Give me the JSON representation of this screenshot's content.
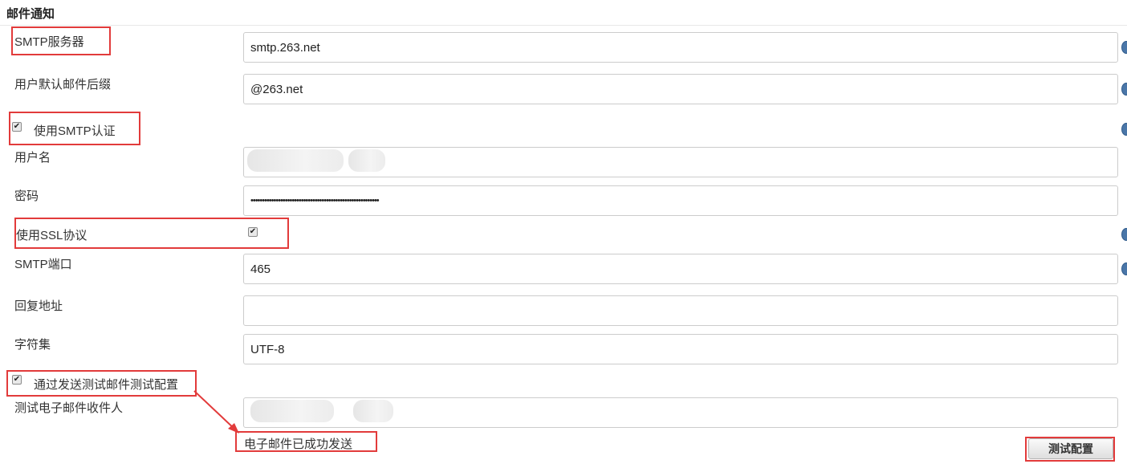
{
  "section": {
    "title": "邮件通知"
  },
  "fields": {
    "smtp_server": {
      "label": "SMTP服务器",
      "value": "smtp.263.net"
    },
    "default_suffix": {
      "label": "用户默认邮件后缀",
      "value": "@263.net"
    },
    "use_smtp_auth": {
      "label": "使用SMTP认证",
      "checked": true
    },
    "username": {
      "label": "用户名",
      "value": "@h        do.com"
    },
    "password": {
      "label": "密码",
      "value": "••••••••••••••••••••••••••••••••••••••••••••••••••••••••"
    },
    "use_ssl": {
      "label": "使用SSL协议",
      "checked": true
    },
    "smtp_port": {
      "label": "SMTP端口",
      "value": "465"
    },
    "reply_to": {
      "label": "回复地址",
      "value": ""
    },
    "charset": {
      "label": "字符集",
      "value": "UTF-8"
    },
    "send_test": {
      "label": "通过发送测试邮件测试配置",
      "checked": true
    },
    "test_recipient": {
      "label": "测试电子邮件收件人",
      "value": "@h        o.com"
    }
  },
  "status": {
    "message": "电子邮件已成功发送"
  },
  "actions": {
    "test_button": "测试配置"
  },
  "icons": {
    "help": "help-icon",
    "check": "✔"
  },
  "colors": {
    "highlight": "#e23b3b",
    "help": "#4a76a8"
  }
}
